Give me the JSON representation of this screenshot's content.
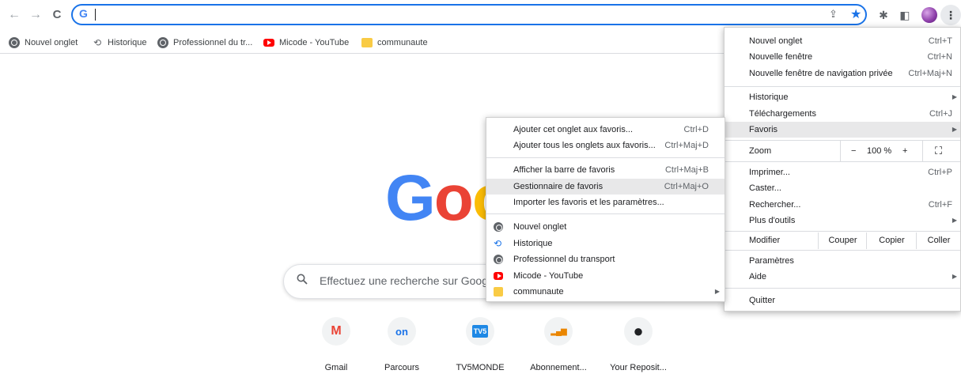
{
  "toolbar": {
    "back_icon": "←",
    "forward_icon": "→",
    "reload_icon": "C",
    "omnibox_icon": "G",
    "omnibox_value": "",
    "share_icon": "⇪",
    "star_icon": "★",
    "extensions_icon": "✱",
    "sidepanel_icon": "◧",
    "menu_icon": "⋮"
  },
  "bookmarks": [
    {
      "label": "Nouvel onglet",
      "icon": "globe-icon"
    },
    {
      "label": "Historique",
      "icon": "history-icon"
    },
    {
      "label": "Professionnel du tr...",
      "icon": "globe-icon"
    },
    {
      "label": "Micode - YouTube",
      "icon": "youtube-icon"
    },
    {
      "label": "communaute",
      "icon": "folder-icon"
    }
  ],
  "logo": {
    "g": "G",
    "o1": "o",
    "o2": "o"
  },
  "search": {
    "placeholder": "Effectuez une recherche sur Goog",
    "icon": "🔍"
  },
  "shortcuts": [
    {
      "label": "Gmail",
      "glyph": "M",
      "color": "#ea4335"
    },
    {
      "label": "Parcours",
      "glyph": "on",
      "color": "#1a73e8"
    },
    {
      "label": "TV5MONDE",
      "glyph": "TV5",
      "color": "#ffffff"
    },
    {
      "label": "Abonnement...",
      "glyph": "▂▄▆",
      "color": "#ea8600"
    },
    {
      "label": "Your Reposit...",
      "glyph": "●",
      "color": "#202124"
    }
  ],
  "menu": {
    "new_tab": {
      "label": "Nouvel onglet",
      "shortcut": "Ctrl+T"
    },
    "new_window": {
      "label": "Nouvelle fenêtre",
      "shortcut": "Ctrl+N"
    },
    "incognito": {
      "label": "Nouvelle fenêtre de navigation privée",
      "shortcut": "Ctrl+Maj+N"
    },
    "history": {
      "label": "Historique"
    },
    "downloads": {
      "label": "Téléchargements",
      "shortcut": "Ctrl+J"
    },
    "favorites": {
      "label": "Favoris"
    },
    "zoom": {
      "label": "Zoom",
      "minus": "−",
      "value": "100 %",
      "plus": "+",
      "fullscreen": "⛶"
    },
    "print": {
      "label": "Imprimer...",
      "shortcut": "Ctrl+P"
    },
    "cast": {
      "label": "Caster..."
    },
    "find": {
      "label": "Rechercher...",
      "shortcut": "Ctrl+F"
    },
    "more_tools": {
      "label": "Plus d'outils"
    },
    "edit": {
      "label": "Modifier",
      "cut": "Couper",
      "copy": "Copier",
      "paste": "Coller"
    },
    "settings": {
      "label": "Paramètres"
    },
    "help": {
      "label": "Aide"
    },
    "quit": {
      "label": "Quitter"
    }
  },
  "submenu": {
    "bookmark_tab": {
      "label": "Ajouter cet onglet aux favoris...",
      "shortcut": "Ctrl+D"
    },
    "bookmark_all": {
      "label": "Ajouter tous les onglets aux favoris...",
      "shortcut": "Ctrl+Maj+D"
    },
    "show_bar": {
      "label": "Afficher la barre de favoris",
      "shortcut": "Ctrl+Maj+B"
    },
    "manager": {
      "label": "Gestionnaire de favoris",
      "shortcut": "Ctrl+Maj+O"
    },
    "import": {
      "label": "Importer les favoris et les paramètres..."
    },
    "items": [
      {
        "label": "Nouvel onglet",
        "icon": "globe-icon"
      },
      {
        "label": "Historique",
        "icon": "history-icon"
      },
      {
        "label": "Professionnel du transport",
        "icon": "globe-icon"
      },
      {
        "label": "Micode - YouTube",
        "icon": "youtube-icon"
      },
      {
        "label": "communaute",
        "icon": "folder-icon"
      }
    ]
  },
  "colors": {
    "accent": "#1a73e8",
    "highlight": "#e8e8e9"
  }
}
